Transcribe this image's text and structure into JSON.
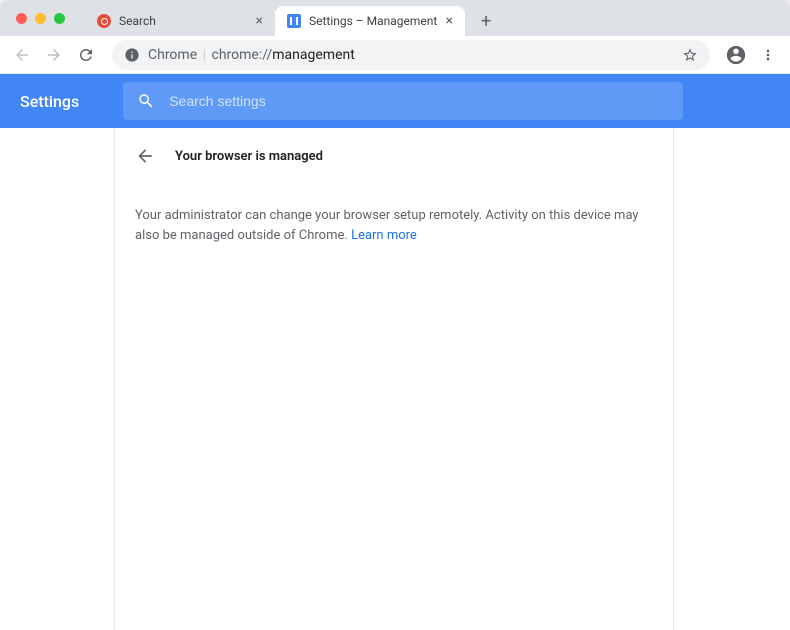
{
  "tabs": [
    {
      "title": "Search"
    },
    {
      "title": "Settings – Management"
    }
  ],
  "address": {
    "protocol": "Chrome",
    "url_prefix": "chrome://",
    "url_path": "management"
  },
  "settings": {
    "title": "Settings",
    "search_placeholder": "Search settings"
  },
  "page": {
    "heading": "Your browser is managed",
    "body": "Your administrator can change your browser setup remotely. Activity on this device may also be managed outside of Chrome.",
    "link_text": "Learn more"
  }
}
